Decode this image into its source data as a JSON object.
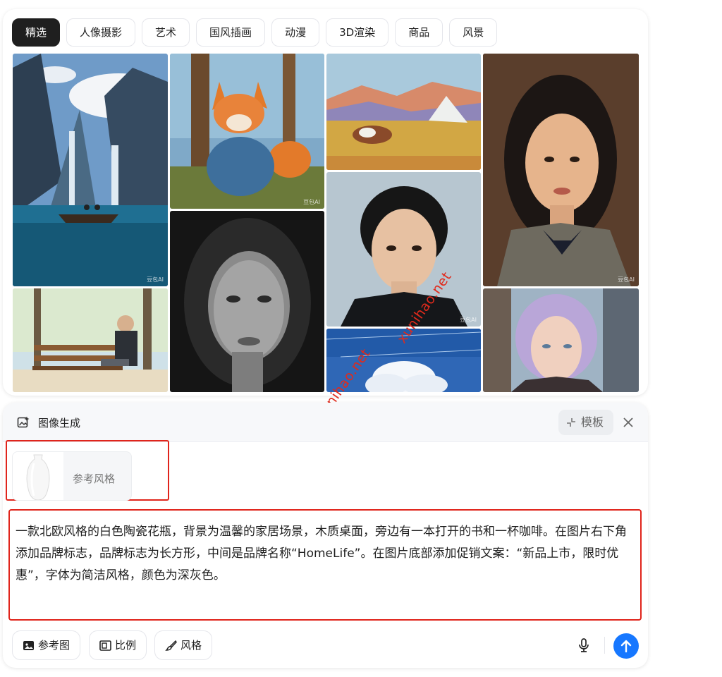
{
  "tabs": [
    {
      "label": "精选",
      "active": true
    },
    {
      "label": "人像摄影",
      "active": false
    },
    {
      "label": "艺术",
      "active": false
    },
    {
      "label": "国风插画",
      "active": false
    },
    {
      "label": "动漫",
      "active": false
    },
    {
      "label": "3D渲染",
      "active": false
    },
    {
      "label": "商品",
      "active": false
    },
    {
      "label": "风景",
      "active": false
    }
  ],
  "gallery": {
    "images": [
      {
        "subject": "mountain-lake-waterfall-boat",
        "tag": "豆包AI"
      },
      {
        "subject": "fox-in-hanfu",
        "tag": "豆包AI"
      },
      {
        "subject": "grassland-cow-yurt",
        "tag": ""
      },
      {
        "subject": "young-woman-portrait",
        "tag": "豆包AI"
      },
      {
        "subject": "black-white-woman-portrait",
        "tag": ""
      },
      {
        "subject": "young-man-portrait",
        "tag": "豆包AI"
      },
      {
        "subject": "old-man-on-bench",
        "tag": ""
      },
      {
        "subject": "sky-clouds",
        "tag": ""
      },
      {
        "subject": "purple-hair-girl",
        "tag": ""
      }
    ]
  },
  "watermark": {
    "text": "xunihao.net"
  },
  "generator": {
    "title": "图像生成",
    "template_label": "模板",
    "reference_label": "参考风格",
    "prompt": "一款北欧风格的白色陶瓷花瓶，背景为温馨的家居场景，木质桌面，旁边有一本打开的书和一杯咖啡。在图片右下角添加品牌标志，品牌标志为长方形，中间是品牌名称“HomeLife”。在图片底部添加促销文案：“新品上市，限时优惠”，字体为简洁风格，颜色为深灰色。",
    "tools": [
      {
        "label": "参考图",
        "icon": "image-icon"
      },
      {
        "label": "比例",
        "icon": "aspect-ratio-icon"
      },
      {
        "label": "风格",
        "icon": "brush-icon"
      }
    ]
  },
  "colors": {
    "accent": "#1677ff",
    "highlight": "#e0241b",
    "active_tab": "#1f1f1f"
  }
}
